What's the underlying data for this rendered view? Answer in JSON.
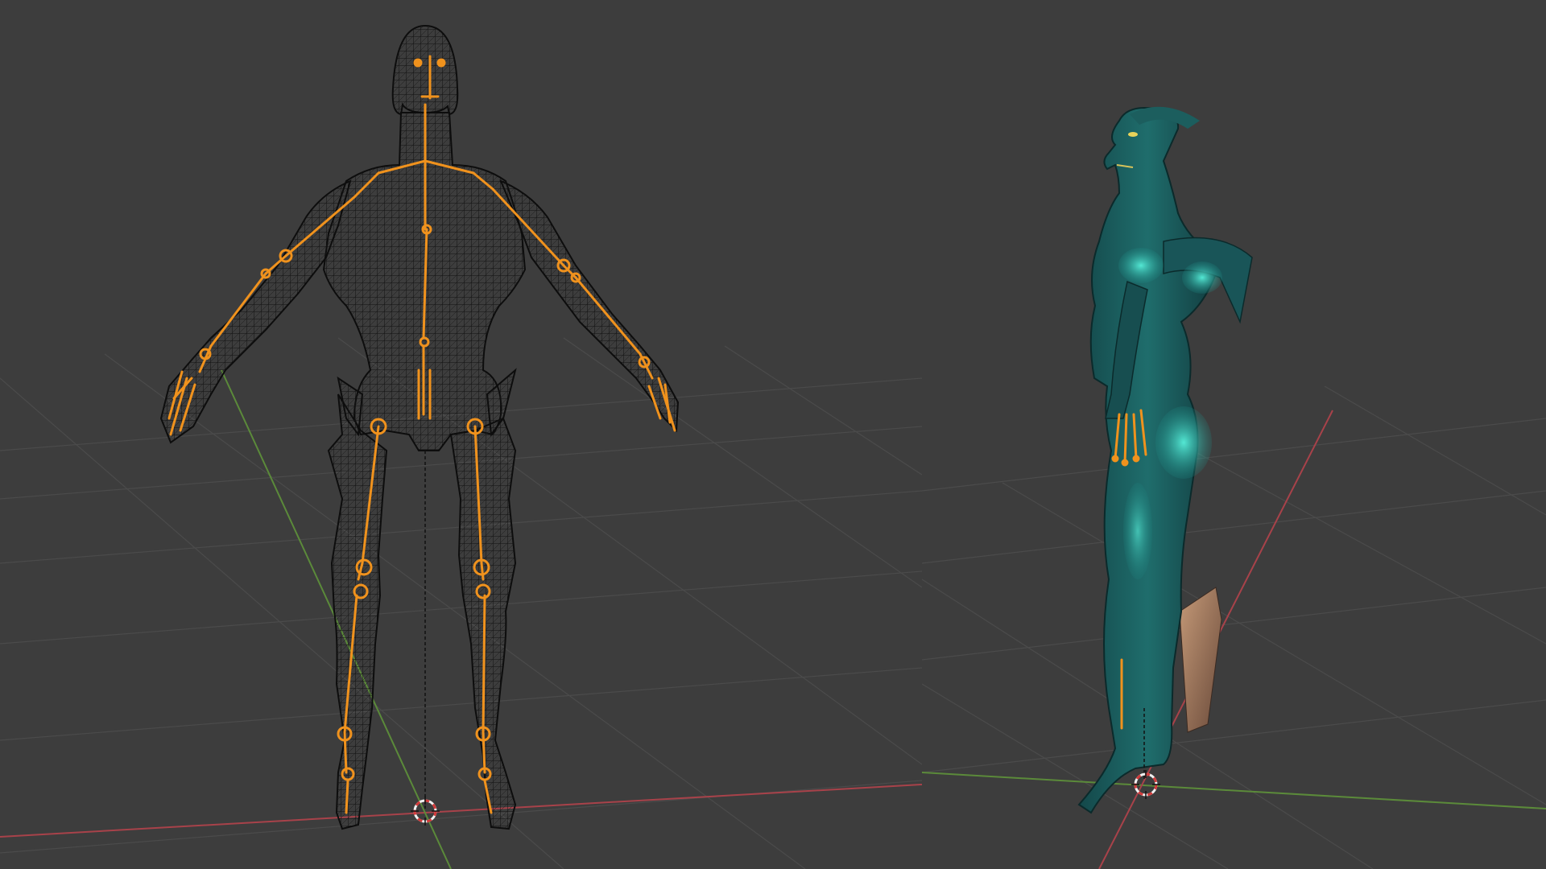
{
  "viewports": [
    {
      "label": "",
      "shading": "wireframe",
      "view": "front",
      "object": "rigged-creature-mesh",
      "armature_visible": true
    },
    {
      "label": "",
      "shading": "material-preview",
      "view": "side",
      "object": "rigged-creature-mesh",
      "armature_visible": true
    }
  ],
  "colors": {
    "background": "#3d3d3d",
    "grid_line": "#4a4a4a",
    "x_axis": "#a8424a",
    "y_axis": "#5b8a3a",
    "bone": "#f0921d",
    "wireframe": "#111111",
    "creature_skin": "#1e6a6a",
    "creature_glow": "#2fc8b8",
    "cursor_red": "#d23a3a",
    "cursor_white": "#f0f0f0"
  },
  "icons": [
    "3d-cursor-icon"
  ]
}
